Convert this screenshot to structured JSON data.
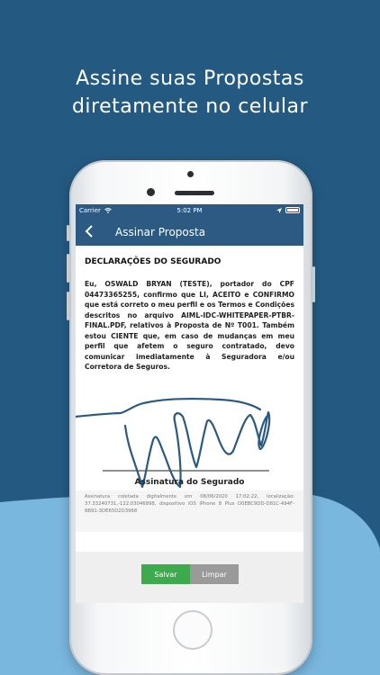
{
  "headline": {
    "line1": "Assine suas Propostas",
    "line2": "diretamente no celular"
  },
  "colors": {
    "background": "#245a82",
    "wave": "#7ab7df",
    "app_bar": "#2d5a82",
    "save": "#3daa4e",
    "clear": "#9a9a9a",
    "signature": "#2a5a82"
  },
  "status_bar": {
    "carrier": "Carrier",
    "time": "5:02 PM"
  },
  "nav": {
    "back_icon": "chevron-left-icon",
    "title": "Assinar Proposta"
  },
  "declaration": {
    "title": "DECLARAÇÕES DO SEGURADO",
    "body": "Eu, OSWALD BRYAN (TESTE), portador do CPF 04473365255, confirmo que LI, ACEITO e CONFIRMO que está correto o meu perfil e os Termos e Condições descritos no arquivo AIML-IDC-WHITEPAPER-PTBR-FINAL.PDF, relativos à Proposta de Nº T001. Também estou CIENTE que, em caso de mudanças em meu perfil que afetem o seguro contratado, devo comunicar imediatamente à Seguradora e/ou Corretora de Seguros."
  },
  "signature": {
    "label": "Assinatura do Segurado",
    "metadata": "Assinatura coletada digitalmente em 08/06/2020 17:02:22, localização: 37.33240731,-122.03046898, dispositivo iOS iPhone 8 Plus D0EBC9DD-D81C-494F-8B91-3DE65D2D3968"
  },
  "actions": {
    "save": "Salvar",
    "clear": "Limpar"
  }
}
